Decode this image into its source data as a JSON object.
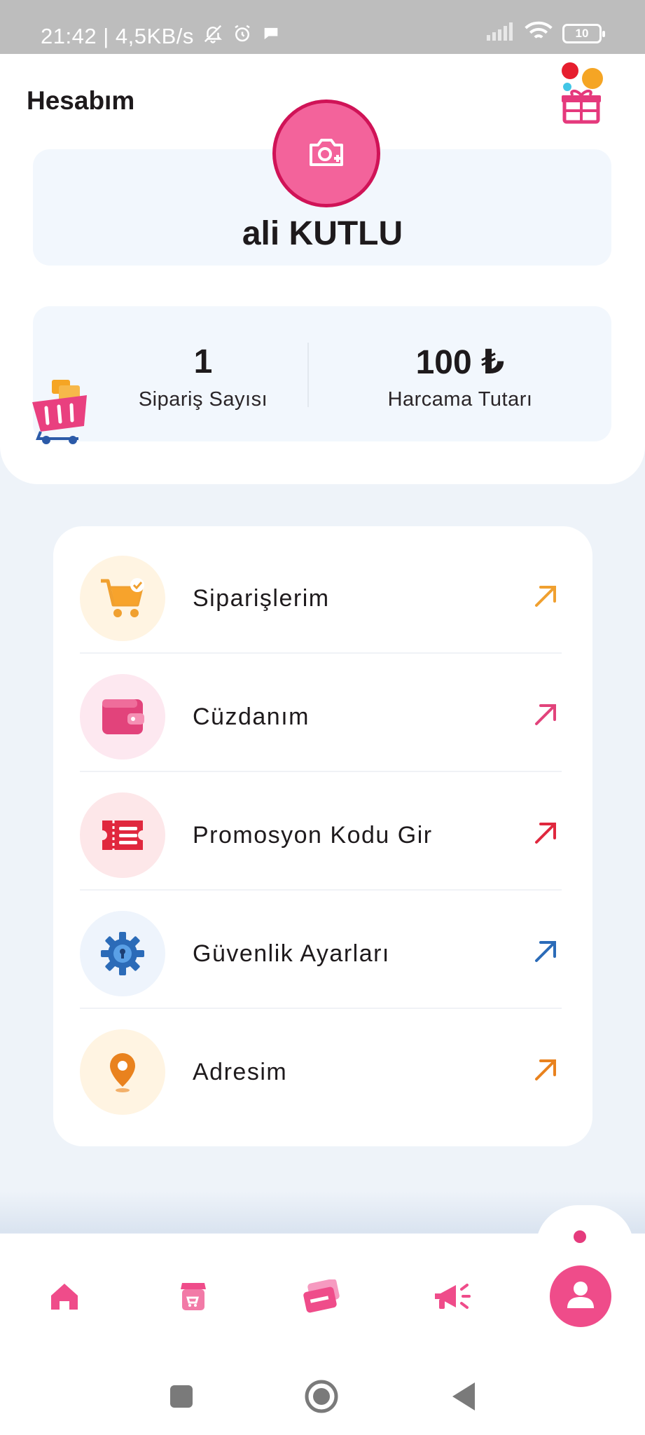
{
  "status_bar": {
    "time_speed": "21:42 | 4,5KB/s",
    "battery": "10"
  },
  "header": {
    "title": "Hesabım"
  },
  "profile": {
    "name": "ali KUTLU"
  },
  "stats": {
    "orders_count": "1",
    "orders_label": "Sipariş Sayısı",
    "spend_amount": "100 ₺",
    "spend_label": "Harcama Tutarı"
  },
  "menu": {
    "items": [
      {
        "label": "Siparişlerim",
        "icon": "shopping-cart-icon",
        "color": "#f0a030",
        "bg": "#fff4e2"
      },
      {
        "label": "Cüzdanım",
        "icon": "wallet-icon",
        "color": "#e2437b",
        "bg": "#fde8f0"
      },
      {
        "label": "Promosyon Kodu Gir",
        "icon": "promo-ticket-icon",
        "color": "#e0283e",
        "bg": "#fde7e9"
      },
      {
        "label": "Güvenlik Ayarları",
        "icon": "security-gear-icon",
        "color": "#2b6bb8",
        "bg": "#eef4fc"
      },
      {
        "label": "Adresim",
        "icon": "location-pin-icon",
        "color": "#e9821e",
        "bg": "#fff4e2"
      }
    ]
  },
  "bottom_nav": {
    "items": [
      "home-icon",
      "store-icon",
      "cards-icon",
      "megaphone-icon",
      "profile-icon"
    ],
    "active": "profile-icon",
    "accent": "#ef4c8a"
  }
}
